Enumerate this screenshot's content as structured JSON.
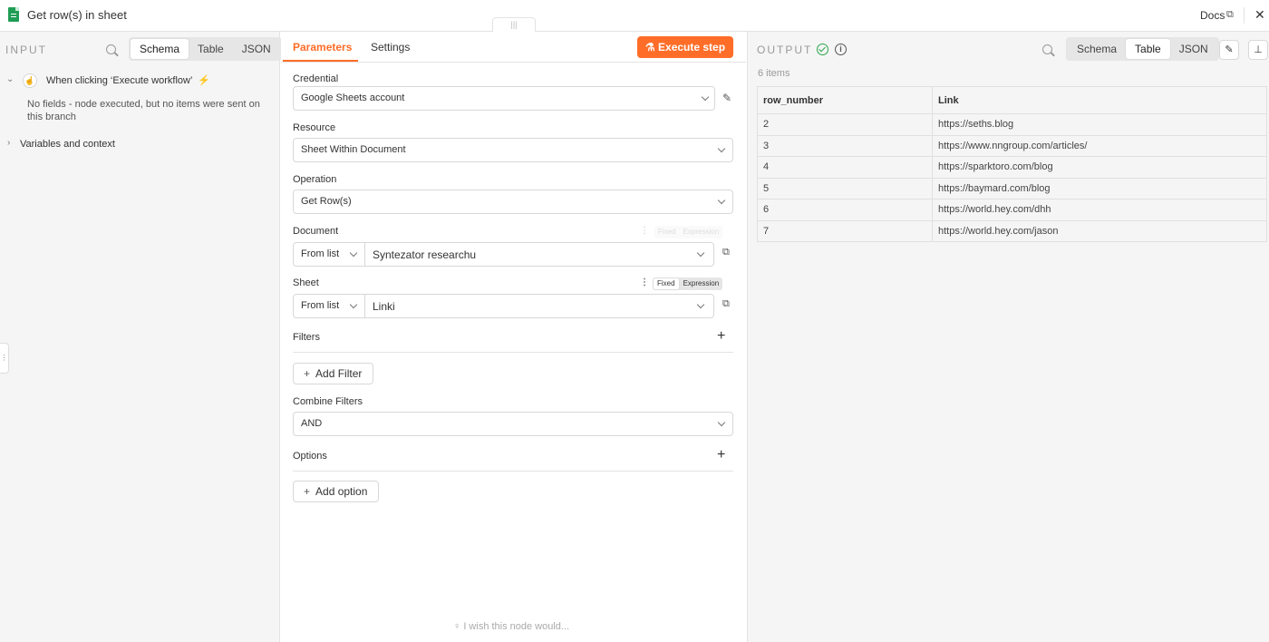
{
  "header": {
    "title": "Get row(s) in sheet",
    "drag_handle": "|||",
    "docs_label": "Docs",
    "close_label": "✕"
  },
  "input": {
    "label": "INPUT",
    "view_tabs": [
      "Schema",
      "Table",
      "JSON"
    ],
    "active_view": "Schema",
    "trigger_label": "When clicking ‘Execute workflow’",
    "no_fields_text": "No fields - node executed, but no items were sent on this branch",
    "variables_label": "Variables and context"
  },
  "params": {
    "tabs": [
      "Parameters",
      "Settings"
    ],
    "active_tab": "Parameters",
    "execute_label": "Execute step",
    "credential": {
      "label": "Credential",
      "value": "Google Sheets account"
    },
    "resource": {
      "label": "Resource",
      "value": "Sheet Within Document"
    },
    "operation": {
      "label": "Operation",
      "value": "Get Row(s)"
    },
    "document": {
      "label": "Document",
      "mode": "From list",
      "value": "Syntezator researchu",
      "fixed": "Fixed",
      "expression": "Expression"
    },
    "sheet": {
      "label": "Sheet",
      "mode": "From list",
      "value": "Linki",
      "fixed": "Fixed",
      "expression": "Expression"
    },
    "filters": {
      "label": "Filters",
      "button": "Add Filter"
    },
    "combine": {
      "label": "Combine Filters",
      "value": "AND"
    },
    "options": {
      "label": "Options",
      "button": "Add option"
    },
    "wish_text": "I wish this node would..."
  },
  "output": {
    "label": "OUTPUT",
    "view_tabs": [
      "Schema",
      "Table",
      "JSON"
    ],
    "active_view": "Table",
    "item_count": "6 items",
    "columns": [
      "row_number",
      "Link"
    ],
    "rows": [
      [
        "2",
        "https://seths.blog"
      ],
      [
        "3",
        "https://www.nngroup.com/articles/"
      ],
      [
        "4",
        "https://sparktoro.com/blog"
      ],
      [
        "5",
        "https://baymard.com/blog"
      ],
      [
        "6",
        "https://world.hey.com/dhh"
      ],
      [
        "7",
        "https://world.hey.com/jason"
      ]
    ]
  },
  "colors": {
    "accent": "#ff6d28",
    "success": "#2aa54b",
    "sheets_green": "#1f9d55"
  }
}
